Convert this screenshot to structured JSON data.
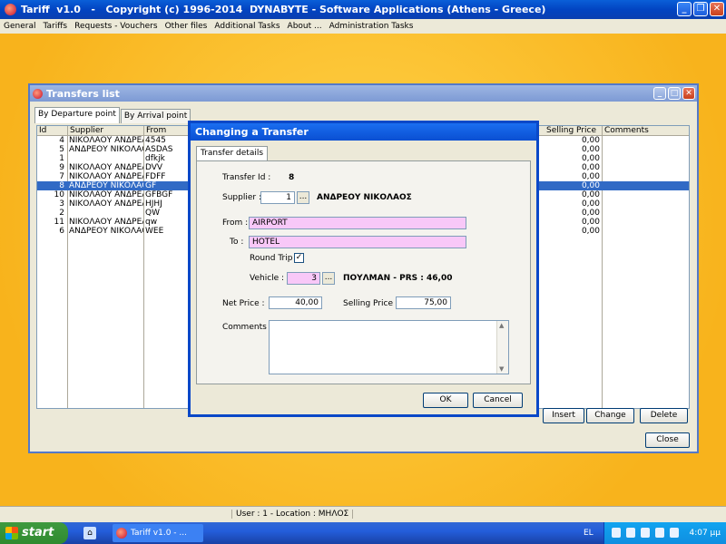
{
  "app": {
    "title": "Tariff  v1.0   -   Copyright (c) 1996-2014  DYNABYTE - Software Applications (Athens - Greece)"
  },
  "menu": [
    "General",
    "Tariffs",
    "Requests - Vouchers",
    "Other files",
    "Additional Tasks",
    "About ...",
    "Administration Tasks"
  ],
  "transfers_list": {
    "title": "Transfers list",
    "tabs": [
      "By Departure point",
      "By Arrival point"
    ],
    "columns": {
      "id": "Id",
      "supplier": "Supplier",
      "from": "From",
      "selling_price": "Selling Price",
      "comments": "Comments"
    },
    "rows": [
      {
        "id": "4",
        "supplier": "ΝΙΚΟΛΑΟΥ ΑΝΔΡΕΑΣ",
        "from": "4545",
        "price": "0,00",
        "selected": false
      },
      {
        "id": "5",
        "supplier": "ΑΝΔΡΕΟΥ ΝΙΚΟΛΑΟΣ",
        "from": "ASDAS",
        "price": "0,00",
        "selected": false
      },
      {
        "id": "1",
        "supplier": "",
        "from": "dfkjk",
        "price": "0,00",
        "selected": false
      },
      {
        "id": "9",
        "supplier": "ΝΙΚΟΛΑΟΥ ΑΝΔΡΕΑΣ",
        "from": "DVV",
        "price": "0,00",
        "selected": false
      },
      {
        "id": "7",
        "supplier": "ΝΙΚΟΛΑΟΥ ΑΝΔΡΕΑΣ",
        "from": "FDFF",
        "price": "0,00",
        "selected": false
      },
      {
        "id": "8",
        "supplier": "ΑΝΔΡΕΟΥ ΝΙΚΟΛΑΟΣ",
        "from": "GF",
        "price": "0,00",
        "selected": true
      },
      {
        "id": "10",
        "supplier": "ΝΙΚΟΛΑΟΥ ΑΝΔΡΕΑΣ",
        "from": "GFBGF",
        "price": "0,00",
        "selected": false
      },
      {
        "id": "3",
        "supplier": "ΝΙΚΟΛΑΟΥ ΑΝΔΡΕΑΣ",
        "from": "HJHJ",
        "price": "0,00",
        "selected": false
      },
      {
        "id": "2",
        "supplier": "",
        "from": "QW",
        "price": "0,00",
        "selected": false
      },
      {
        "id": "11",
        "supplier": "ΝΙΚΟΛΑΟΥ ΑΝΔΡΕΑΣ",
        "from": "qw",
        "price": "0,00",
        "selected": false
      },
      {
        "id": "6",
        "supplier": "ΑΝΔΡΕΟΥ ΝΙΚΟΛΑΟΣ",
        "from": "WEE",
        "price": "0,00",
        "selected": false
      }
    ],
    "buttons": {
      "insert": "Insert",
      "change": "Change",
      "delete": "Delete",
      "close": "Close"
    }
  },
  "dialog": {
    "title": "Changing a Transfer",
    "tab": "Transfer details",
    "transfer_id_label": "Transfer Id :",
    "transfer_id": "8",
    "supplier_label": "Supplier :",
    "supplier_code": "1",
    "supplier_name": "ΑΝΔΡΕΟΥ ΝΙΚΟΛΑΟΣ",
    "from_label": "From :",
    "from_value": "AIRPORT",
    "to_label": "To :",
    "to_value": "HOTEL",
    "round_trip_label": "Round Trip",
    "round_trip_checked": true,
    "vehicle_label": "Vehicle :",
    "vehicle_code": "3",
    "vehicle_name": "ΠΟΥΛΜΑΝ - PRS : 46,00",
    "net_price_label": "Net Price :",
    "net_price": "40,00",
    "selling_price_label": "Selling Price :",
    "selling_price": "75,00",
    "comments_label": "Comments :",
    "ellipsis": "...",
    "ok": "OK",
    "cancel": "Cancel"
  },
  "status": {
    "text": "User : 1  -  Location : ΜΗΛΟΣ"
  },
  "taskbar": {
    "start": "start",
    "task": "Tariff  v1.0  -  ...",
    "lang": "EL",
    "clock": "4:07 μμ"
  },
  "colors": {
    "accent": "#0a48c8",
    "desktop": "#fcc330",
    "selected_row": "#316ac5",
    "pink_field": "#f8c8f8"
  }
}
